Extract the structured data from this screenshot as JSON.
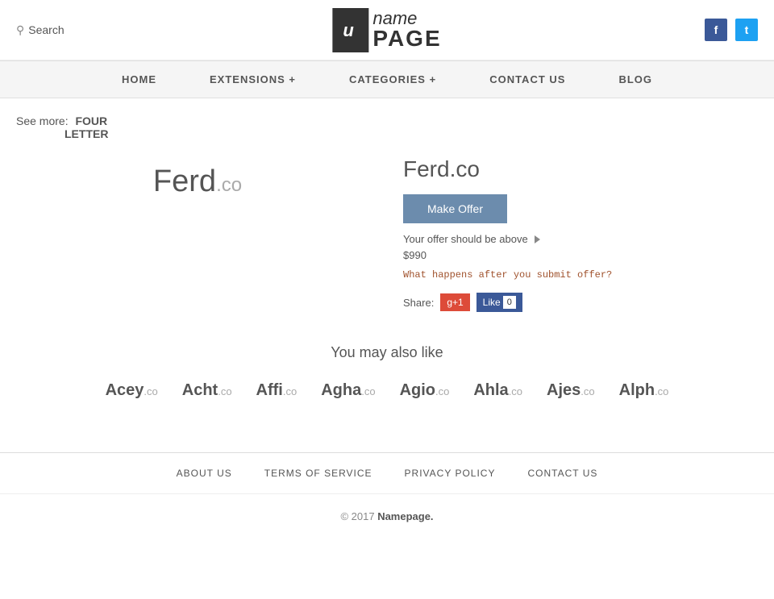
{
  "header": {
    "search_label": "Search",
    "logo_icon_char": "u",
    "logo_name": "name",
    "logo_page": "PAGE",
    "social": [
      {
        "name": "facebook",
        "label": "f"
      },
      {
        "name": "twitter",
        "label": "t"
      }
    ]
  },
  "nav": {
    "items": [
      {
        "id": "home",
        "label": "HOME"
      },
      {
        "id": "extensions",
        "label": "EXTENSIONS +"
      },
      {
        "id": "categories",
        "label": "CATEGORIES +"
      },
      {
        "id": "contact",
        "label": "CONTACT US"
      },
      {
        "id": "blog",
        "label": "BLOG"
      }
    ]
  },
  "breadcrumb": {
    "see_more_label": "See more:",
    "link_line1": "FOUR",
    "link_line2": "LETTER"
  },
  "domain": {
    "name": "Ferd",
    "tld": ".co",
    "full": "Ferd.co",
    "make_offer_label": "Make Offer",
    "offer_hint": "Your offer should be above",
    "offer_min": "$990",
    "offer_question": "What happens after you submit offer?",
    "share_label": "Share:",
    "gplus_label": "g+1",
    "fb_like_label": "Like",
    "like_count": "0"
  },
  "also_like": {
    "title": "You may also like",
    "items": [
      {
        "name": "Acey",
        "tld": ".co"
      },
      {
        "name": "Acht",
        "tld": ".co"
      },
      {
        "name": "Affi",
        "tld": ".co"
      },
      {
        "name": "Agha",
        "tld": ".co"
      },
      {
        "name": "Agio",
        "tld": ".co"
      },
      {
        "name": "Ahla",
        "tld": ".co"
      },
      {
        "name": "Ajes",
        "tld": ".co"
      },
      {
        "name": "Alph",
        "tld": ".co"
      }
    ]
  },
  "footer": {
    "nav_items": [
      {
        "id": "about",
        "label": "ABOUT US"
      },
      {
        "id": "terms",
        "label": "TERMS OF SERVICE"
      },
      {
        "id": "privacy",
        "label": "PRIVACY POLICY"
      },
      {
        "id": "contact",
        "label": "CONTACT US"
      }
    ],
    "copyright": "© 2017",
    "brand": "Namepage."
  }
}
